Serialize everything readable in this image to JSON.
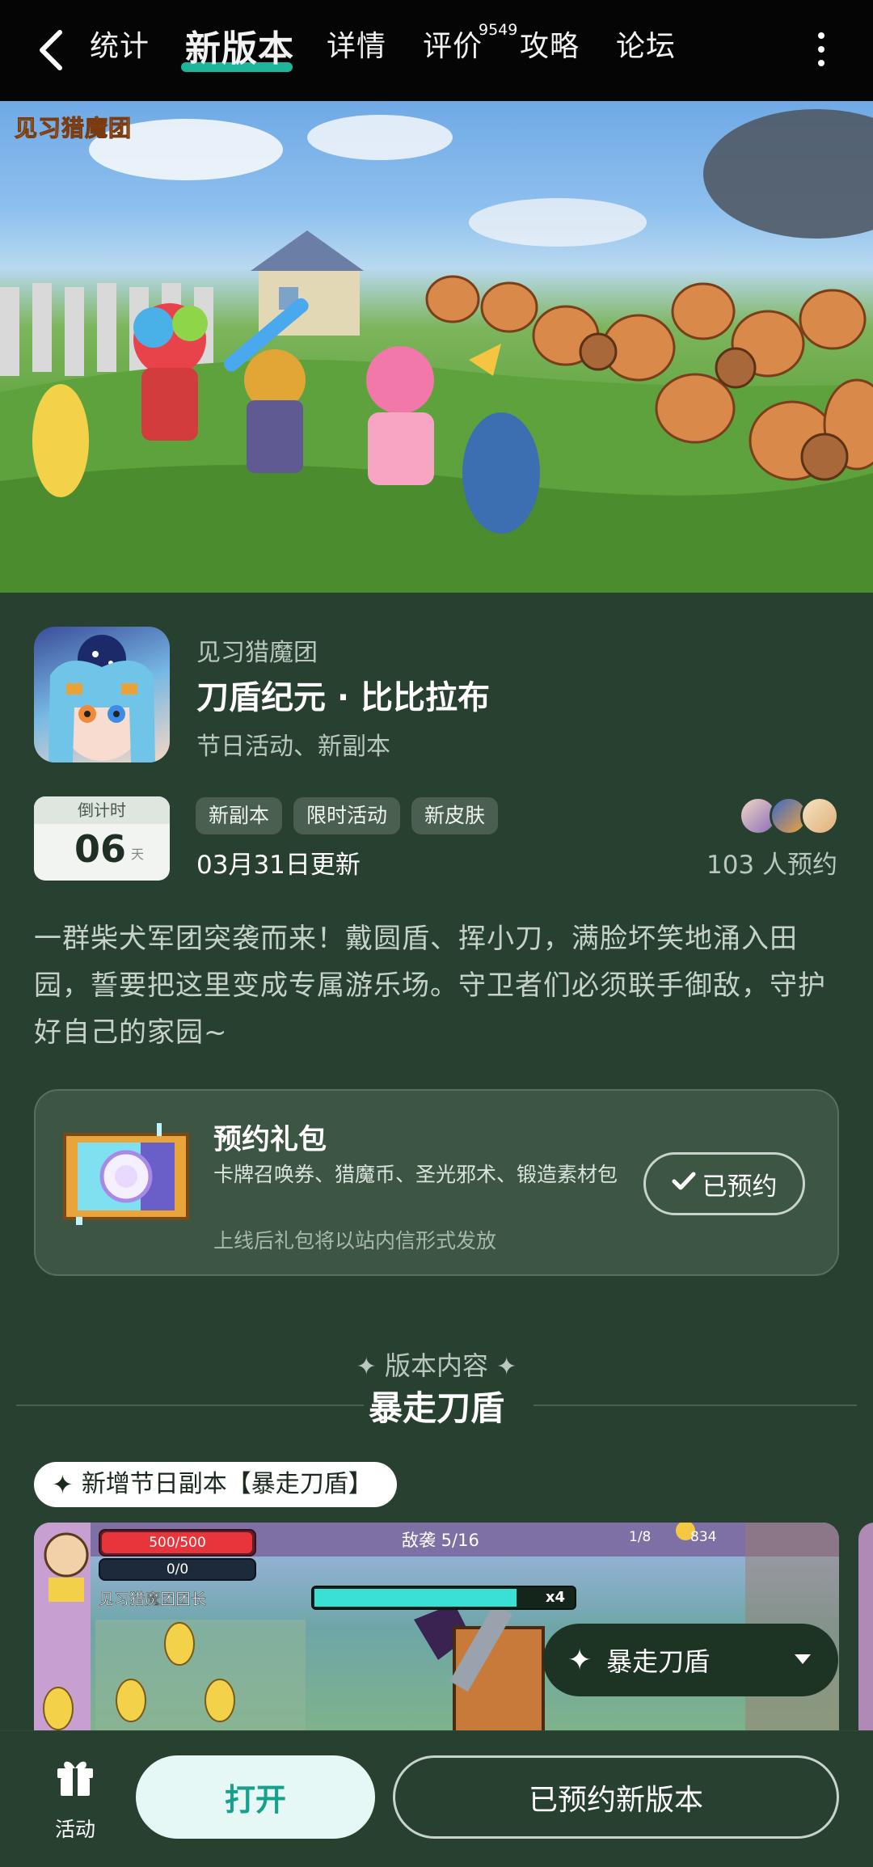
{
  "nav": {
    "tabs": [
      "统计",
      "新版本",
      "详情",
      "评价",
      "攻略",
      "论坛"
    ],
    "active_tab": "新版本",
    "review_count": "9549"
  },
  "hero": {
    "logo_text": "见习猎魔团"
  },
  "app": {
    "developer": "见习猎魔团",
    "title": "刀盾纪元 · 比比拉布",
    "subtitle": "节日活动、新副本"
  },
  "countdown": {
    "label": "倒计时",
    "number": "06",
    "unit": "天"
  },
  "tags": [
    "新副本",
    "限时活动",
    "新皮肤"
  ],
  "update_date": "03月31日更新",
  "reservations": "103 人预约",
  "description": "一群柴犬军团突袭而来！戴圆盾、挥小刀，满脸坏笑地涌入田园，誓要把这里变成专属游乐场。守卫者们必须联手御敌，守护好自己的家园~",
  "gift": {
    "title": "预约礼包",
    "items": "卡牌召唤券、猎魔币、圣光邪术、锻造素材包",
    "note": "上线后礼包将以站内信形式发放",
    "button": "已预约"
  },
  "section": {
    "small_title": "版本内容",
    "big_title": "暴走刀盾"
  },
  "feature_pill": "新增节日副本【暴走刀盾】",
  "game_hud": {
    "hp": "500/500",
    "mp": "0/0",
    "player_name": "见习猎魔团团长",
    "wave": "敌袭 5/16",
    "counter": "1/8",
    "coins": "834",
    "enemy_multiplier": "x4"
  },
  "dropdown": {
    "label": "暴走刀盾"
  },
  "bottom": {
    "activity_label": "活动",
    "open_button": "打开",
    "reserve_button": "已预约新版本"
  },
  "colors": {
    "background": "#28402f",
    "accent": "#1fb59a",
    "topbar": "#050505"
  }
}
